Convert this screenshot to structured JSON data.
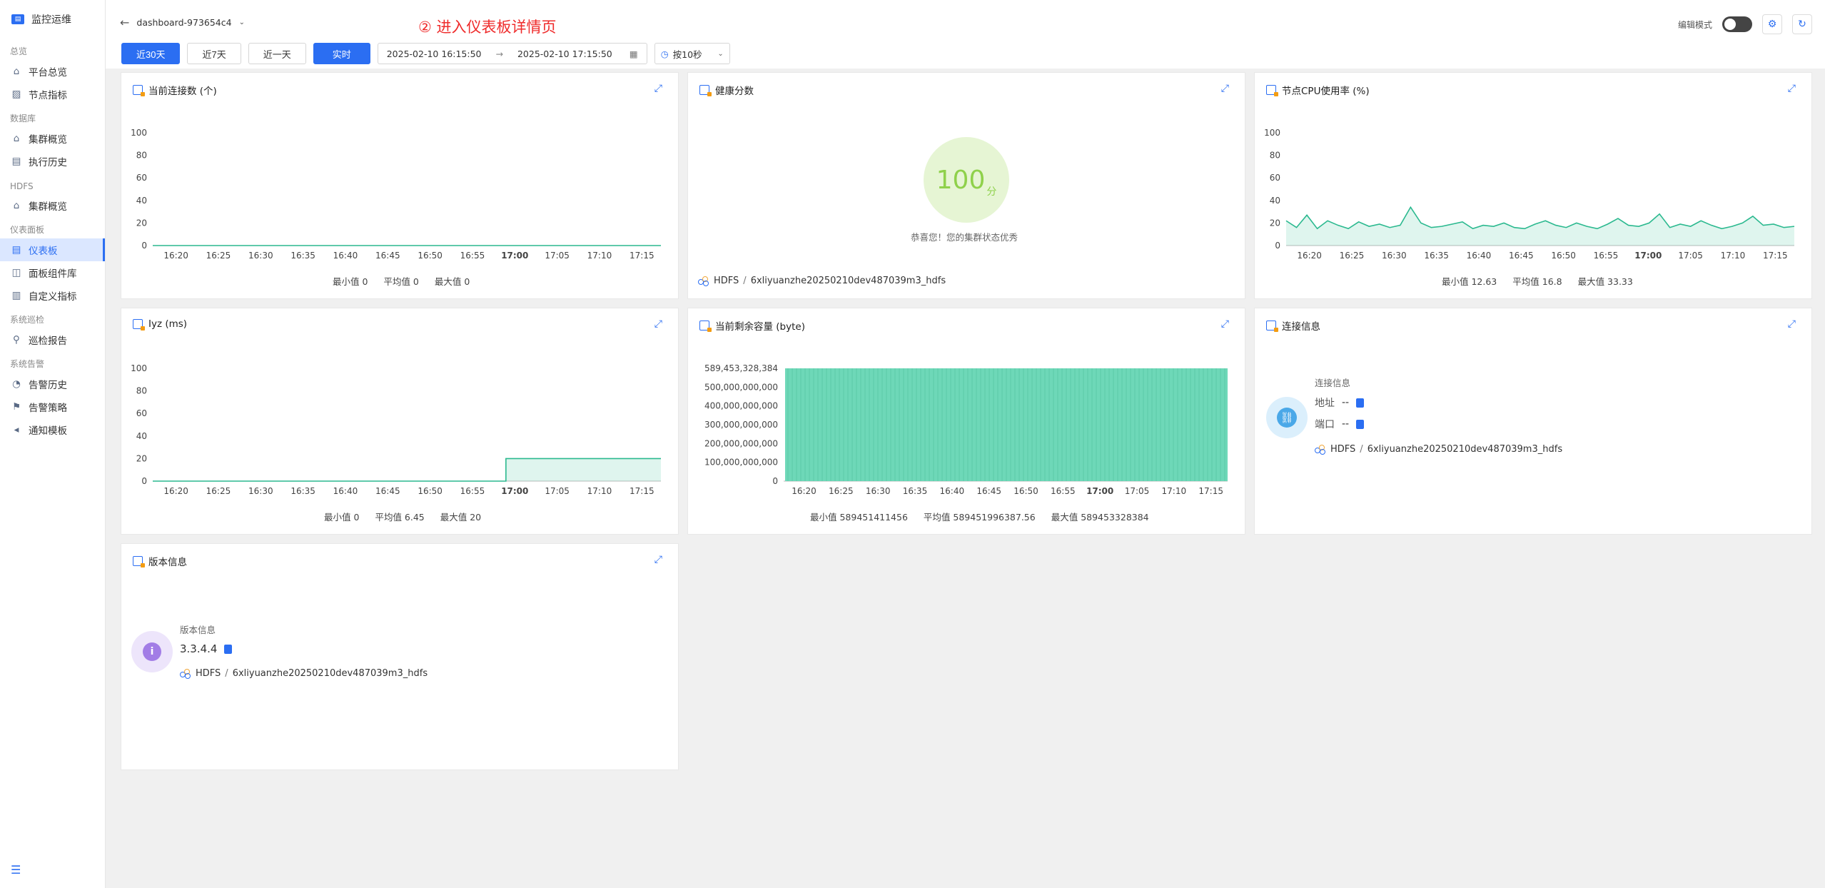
{
  "sidebar": {
    "brand": "监控运维",
    "groups": [
      {
        "title": "总览",
        "items": [
          "平台总览",
          "节点指标"
        ]
      },
      {
        "title": "数据库",
        "items": [
          "集群概览",
          "执行历史"
        ]
      },
      {
        "title": "HDFS",
        "items": [
          "集群概览"
        ]
      },
      {
        "title": "仪表面板",
        "items": [
          "仪表板",
          "面板组件库",
          "自定义指标"
        ]
      },
      {
        "title": "系统巡检",
        "items": [
          "巡检报告"
        ]
      },
      {
        "title": "系统告警",
        "items": [
          "告警历史",
          "告警策略",
          "通知模板"
        ]
      }
    ],
    "active_item": "仪表板"
  },
  "header": {
    "dashboard_name": "dashboard-973654c4",
    "annotation": "② 进入仪表板详情页",
    "edit_mode_label": "编辑模式",
    "edit_mode_on": false
  },
  "filters": {
    "buttons": [
      "近30天",
      "近7天",
      "近一天",
      "实时"
    ],
    "start_time": "2025-02-10 16:15:50",
    "end_time": "2025-02-10 17:15:50",
    "refresh_interval": "按10秒"
  },
  "time_ticks": [
    "16:20",
    "16:25",
    "16:30",
    "16:35",
    "16:40",
    "16:45",
    "16:50",
    "16:55",
    "17:00",
    "17:05",
    "17:10",
    "17:15"
  ],
  "panels": {
    "connections": {
      "title": "当前连接数 (个)",
      "stats": {
        "min": "最小值 0",
        "avg": "平均值 0",
        "max": "最大值 0"
      }
    },
    "health": {
      "title": "健康分数",
      "score": "100",
      "unit": "分",
      "message": "恭喜您！您的集群状态优秀",
      "source_type": "HDFS",
      "source_name": "6xliyuanzhe20250210dev487039m3_hdfs"
    },
    "cpu": {
      "title": "节点CPU使用率 (%)",
      "stats": {
        "min": "最小值 12.63",
        "avg": "平均值 16.8",
        "max": "最大值 33.33"
      }
    },
    "iyz": {
      "title": "Iyz (ms)",
      "stats": {
        "min": "最小值 0",
        "avg": "平均值 6.45",
        "max": "最大值 20"
      }
    },
    "capacity": {
      "title": "当前剩余容量 (byte)",
      "stats": {
        "min": "最小值 589451411456",
        "avg": "平均值 589451996387.56",
        "max": "最大值 589453328384"
      }
    },
    "connection_info": {
      "title": "连接信息",
      "label": "连接信息",
      "address_label": "地址",
      "address_value": "--",
      "port_label": "端口",
      "port_value": "--",
      "source_type": "HDFS",
      "source_name": "6xliyuanzhe20250210dev487039m3_hdfs"
    },
    "version": {
      "title": "版本信息",
      "label": "版本信息",
      "value": "3.3.4.4",
      "source_type": "HDFS",
      "source_name": "6xliyuanzhe20250210dev487039m3_hdfs"
    }
  },
  "chart_data": [
    {
      "type": "line",
      "title": "当前连接数 (个)",
      "x": [
        "16:20",
        "16:25",
        "16:30",
        "16:35",
        "16:40",
        "16:45",
        "16:50",
        "16:55",
        "17:00",
        "17:05",
        "17:10",
        "17:15"
      ],
      "series": [
        {
          "values": [
            0,
            0,
            0,
            0,
            0,
            0,
            0,
            0,
            0,
            0,
            0,
            0
          ]
        }
      ],
      "yticks": [
        "0",
        "20",
        "40",
        "60",
        "80",
        "100"
      ],
      "ylim": [
        0,
        100
      ],
      "color": "#2bb98f"
    },
    {
      "type": "area",
      "title": "节点CPU使用率 (%)",
      "x": [
        "16:20",
        "16:25",
        "16:30",
        "16:35",
        "16:40",
        "16:45",
        "16:50",
        "16:55",
        "17:00",
        "17:05",
        "17:10",
        "17:15"
      ],
      "series": [
        {
          "values": [
            22,
            16,
            27,
            15,
            22,
            18,
            15,
            21,
            17,
            19,
            16,
            18,
            34,
            20,
            16,
            17,
            19,
            21,
            15,
            18,
            17,
            20,
            16,
            15,
            19,
            22,
            18,
            16,
            20,
            17,
            15,
            19,
            24,
            18,
            17,
            20,
            28,
            16,
            19,
            17,
            22,
            18,
            15,
            17,
            20,
            26,
            18,
            19,
            16,
            17
          ]
        }
      ],
      "yticks": [
        "0",
        "20",
        "40",
        "60",
        "80",
        "100"
      ],
      "ylim": [
        0,
        100
      ],
      "color": "#2bb98f"
    },
    {
      "type": "area",
      "title": "Iyz (ms)",
      "x": [
        "16:20",
        "16:25",
        "16:30",
        "16:35",
        "16:40",
        "16:45",
        "16:50",
        "16:55",
        "17:00",
        "17:05",
        "17:10",
        "17:15"
      ],
      "series": [
        {
          "values": [
            0,
            0,
            0,
            0,
            0,
            0,
            0,
            0,
            20,
            20,
            20,
            20
          ]
        }
      ],
      "step_at": "16:58",
      "yticks": [
        "0",
        "20",
        "40",
        "60",
        "80",
        "100"
      ],
      "ylim": [
        0,
        100
      ],
      "color": "#2bb98f"
    },
    {
      "type": "bar",
      "title": "当前剩余容量 (byte)",
      "x": [
        "16:20",
        "16:25",
        "16:30",
        "16:35",
        "16:40",
        "16:45",
        "16:50",
        "16:55",
        "17:00",
        "17:05",
        "17:10",
        "17:15"
      ],
      "series": [
        {
          "values": [
            589452000000
          ]
        }
      ],
      "yticks": [
        "0",
        "100,000,000,000",
        "200,000,000,000",
        "300,000,000,000",
        "400,000,000,000",
        "500,000,000,000",
        "589,453,328,384"
      ],
      "ylim": [
        0,
        589453328384
      ],
      "color": "#6ed8b8"
    }
  ]
}
